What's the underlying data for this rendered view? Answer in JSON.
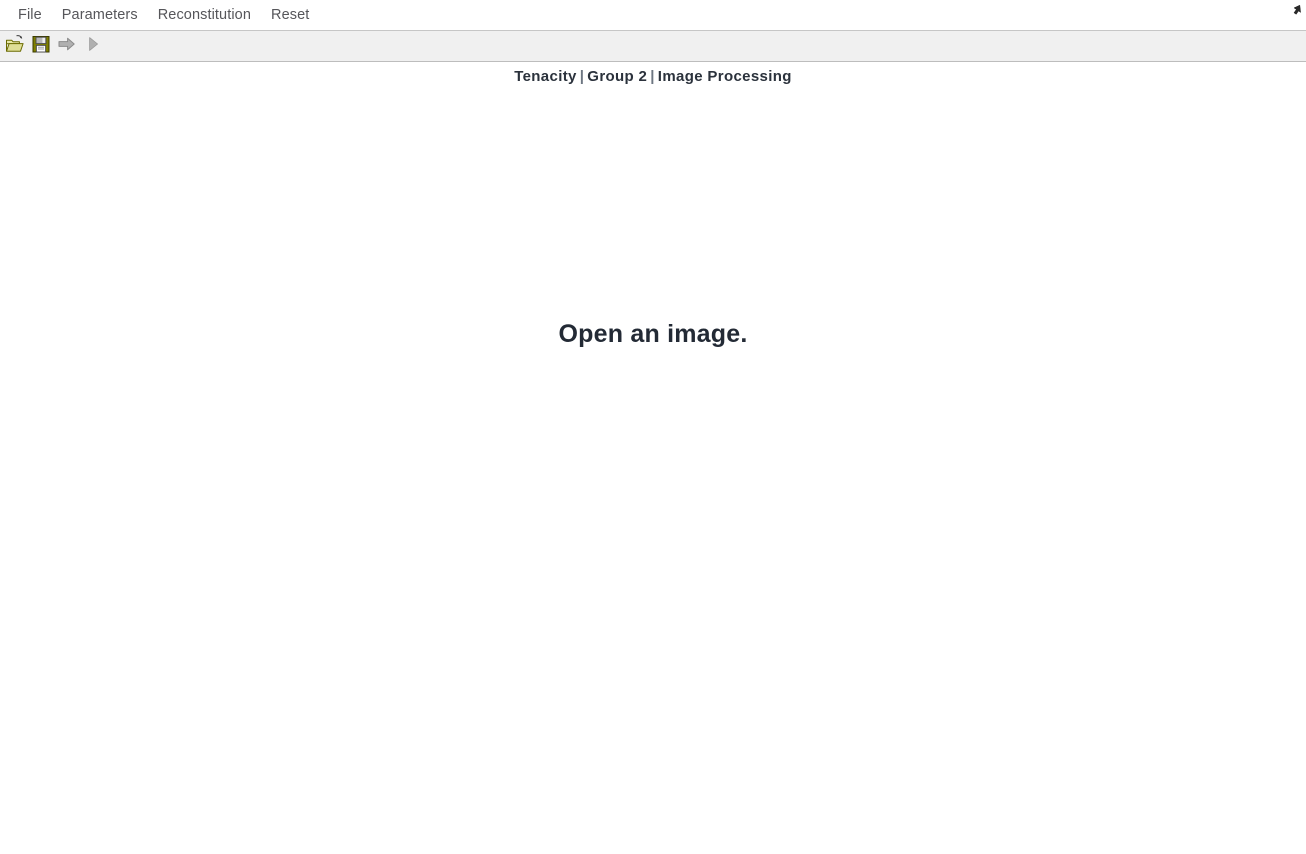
{
  "window": {
    "title": "Tenacity | Group 2 | Image Processing"
  },
  "menubar": {
    "items": [
      {
        "label": "File",
        "name": "menu-file"
      },
      {
        "label": "Parameters",
        "name": "menu-parameters"
      },
      {
        "label": "Reconstitution",
        "name": "menu-reconstitution"
      },
      {
        "label": "Reset",
        "name": "menu-reset"
      }
    ]
  },
  "toolbar": {
    "buttons": [
      {
        "icon": "open-folder-icon",
        "tooltip": "Open"
      },
      {
        "icon": "save-floppy-icon",
        "tooltip": "Save"
      },
      {
        "icon": "arrow-right-icon",
        "tooltip": "Process"
      },
      {
        "icon": "play-triangle-icon",
        "tooltip": "Run"
      }
    ]
  },
  "header": {
    "app_name": "Tenacity",
    "separator": "|",
    "group": "Group 2",
    "subject": "Image Processing"
  },
  "main": {
    "placeholder": "Open an image."
  },
  "pointer": {
    "icon": "mouse-cursor-icon"
  },
  "colors": {
    "menu_text": "#56565a",
    "header_text": "#2b323c",
    "placeholder_text": "#232a35",
    "toolbar_bg": "#f0f0f0",
    "toolbar_border": "#c6c6c6",
    "icon_olive": "#808000",
    "icon_yellow": "#e8e8a0",
    "icon_gray": "#9a9a9a",
    "page_bg": "#ffffff"
  }
}
